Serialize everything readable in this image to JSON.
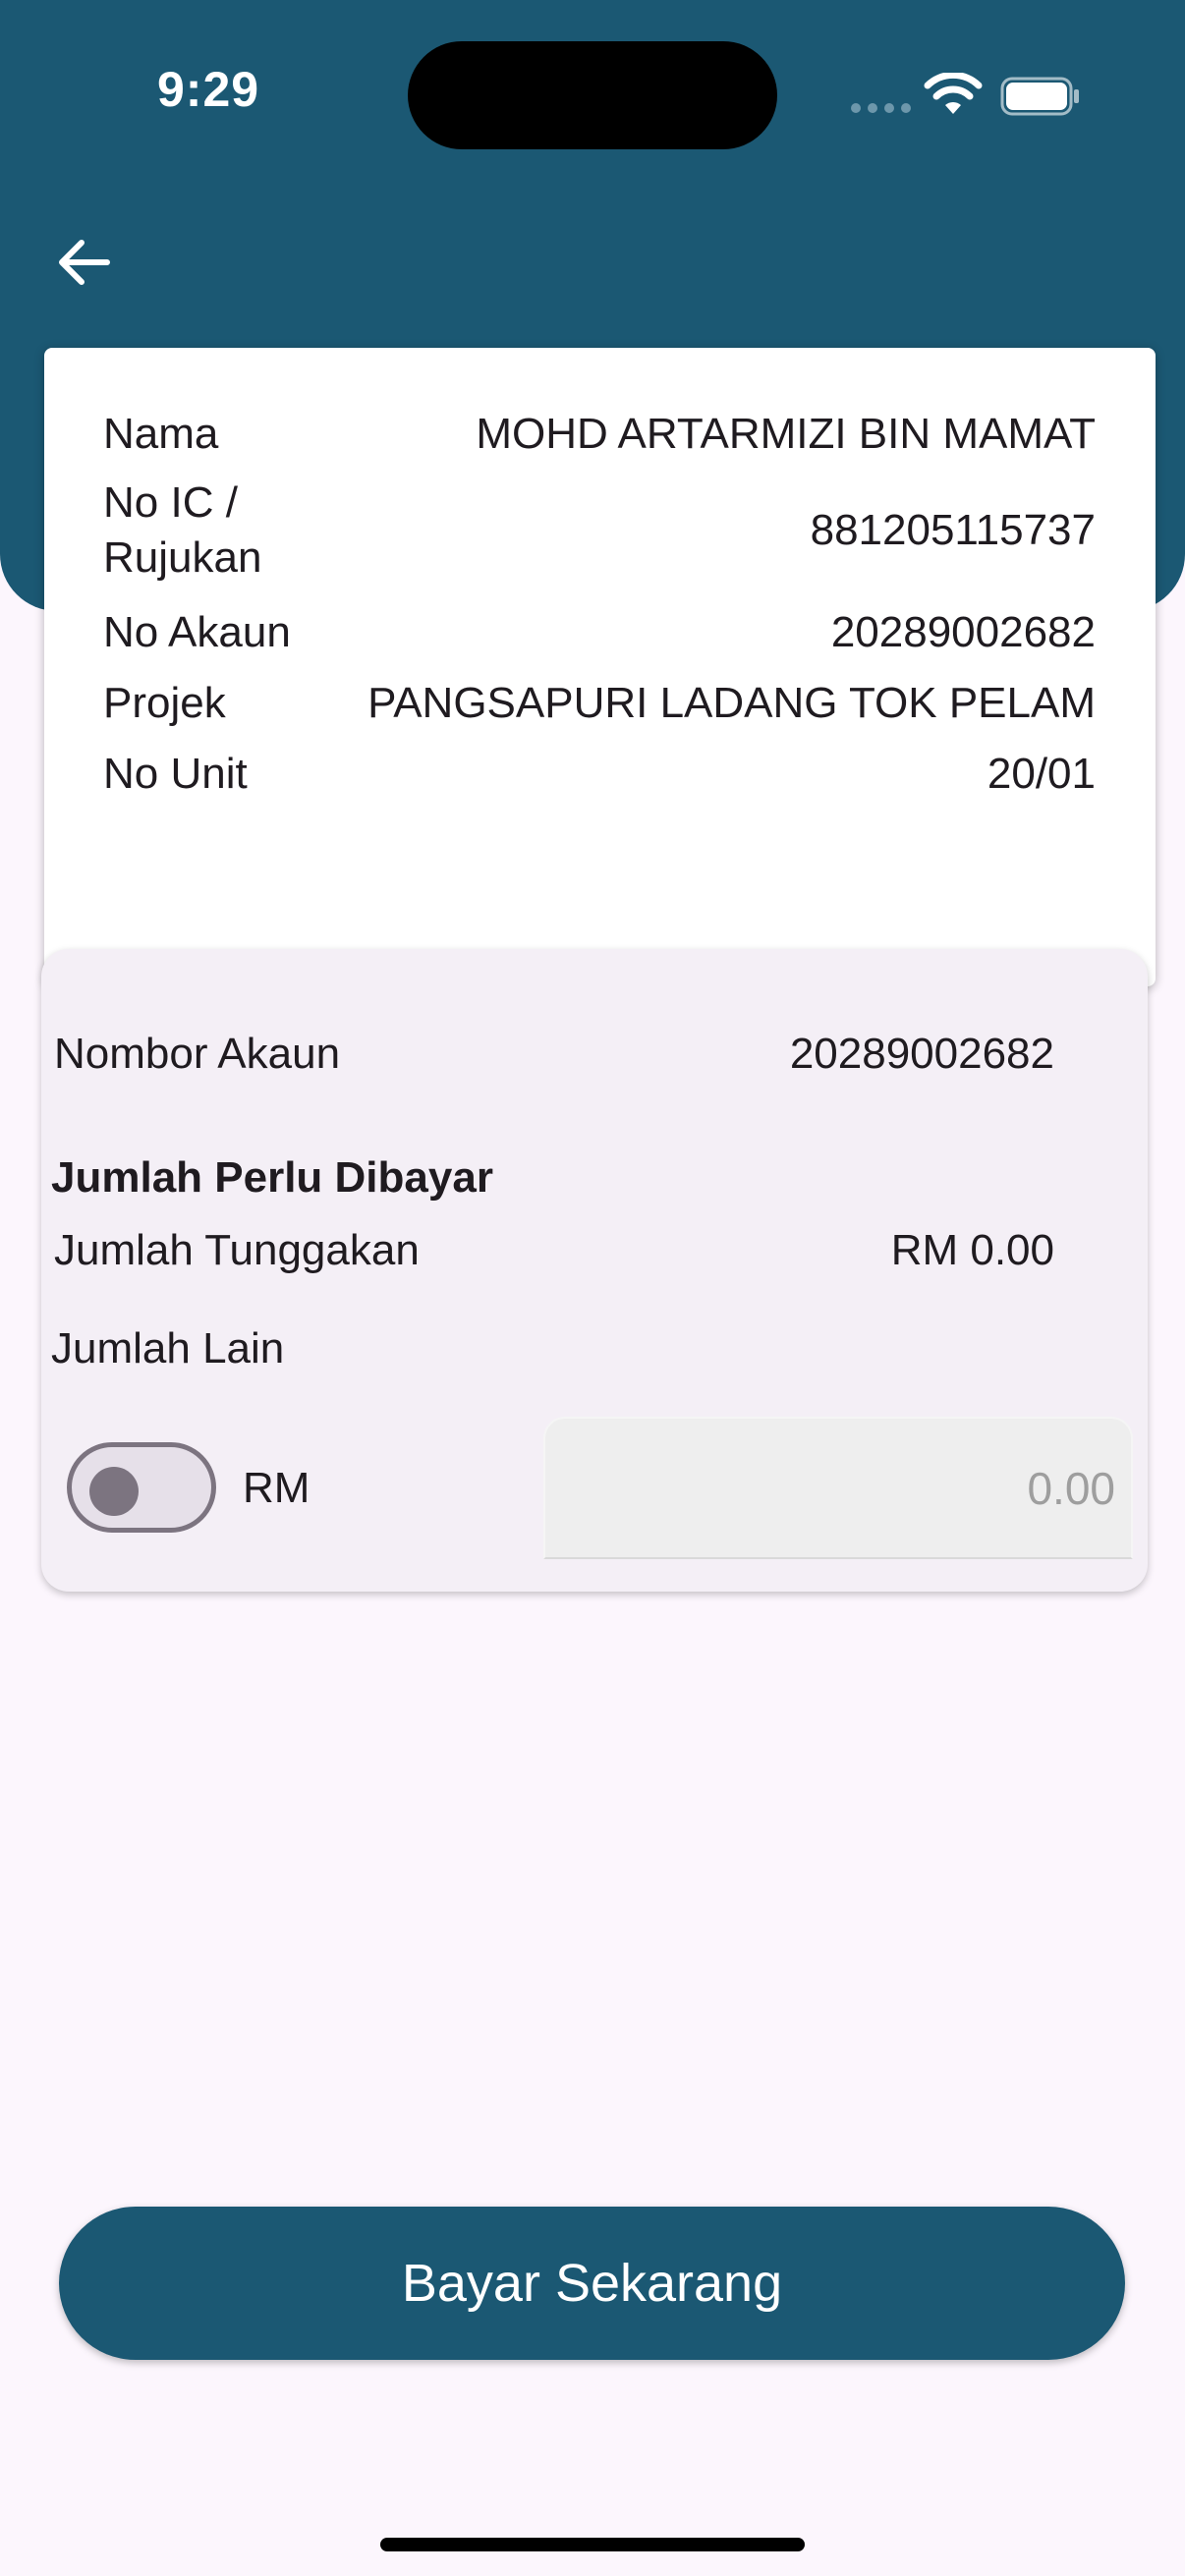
{
  "status_bar": {
    "time": "9:29"
  },
  "colors": {
    "primary": "#1b5873",
    "background": "#fcf6fd",
    "card": "#ffffff",
    "payment_card": "#f4eff6"
  },
  "header": {
    "back_icon": "arrow-left-icon"
  },
  "account_info": {
    "rows": [
      {
        "label": "Nama",
        "value": "MOHD ARTARMIZI BIN MAMAT"
      },
      {
        "label": "No IC /\nRujukan",
        "value": "881205115737"
      },
      {
        "label": "No Akaun",
        "value": "20289002682"
      },
      {
        "label": "Projek",
        "value": "PANGSAPURI LADANG TOK PELAM"
      },
      {
        "label": "No Unit",
        "value": "20/01"
      }
    ]
  },
  "payment": {
    "account_number_label": "Nombor Akaun",
    "account_number_value": "20289002682",
    "amount_due_heading": "Jumlah Perlu Dibayar",
    "arrears_label": "Jumlah Tunggakan",
    "arrears_value": "RM 0.00",
    "other_amount_label": "Jumlah Lain",
    "toggle_on": false,
    "currency_label": "RM",
    "amount_placeholder": "0.00"
  },
  "actions": {
    "pay_now_label": "Bayar Sekarang"
  }
}
